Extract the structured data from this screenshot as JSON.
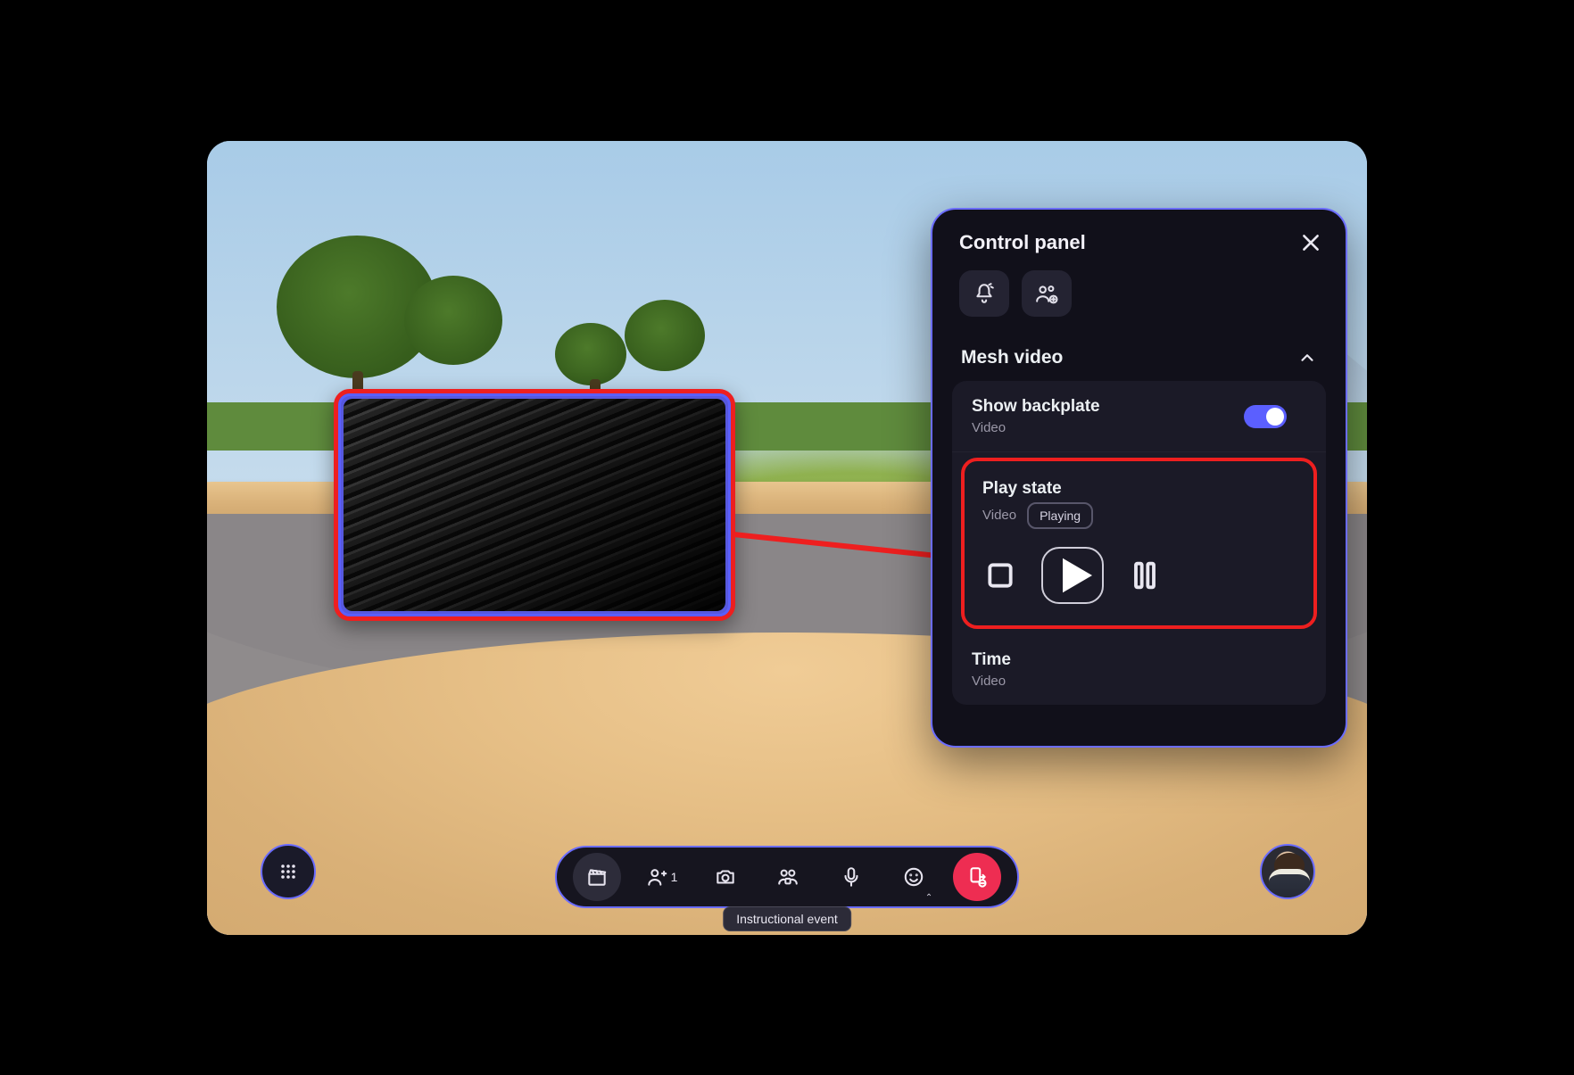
{
  "panel": {
    "title": "Control panel",
    "section_title": "Mesh video",
    "backplate": {
      "title": "Show backplate",
      "sub": "Video",
      "toggle_on": true
    },
    "playstate": {
      "title": "Play state",
      "sub": "Video",
      "badge": "Playing"
    },
    "time": {
      "title": "Time",
      "sub": "Video"
    }
  },
  "toolbar": {
    "people_count": "1",
    "tooltip": "Instructional event"
  }
}
